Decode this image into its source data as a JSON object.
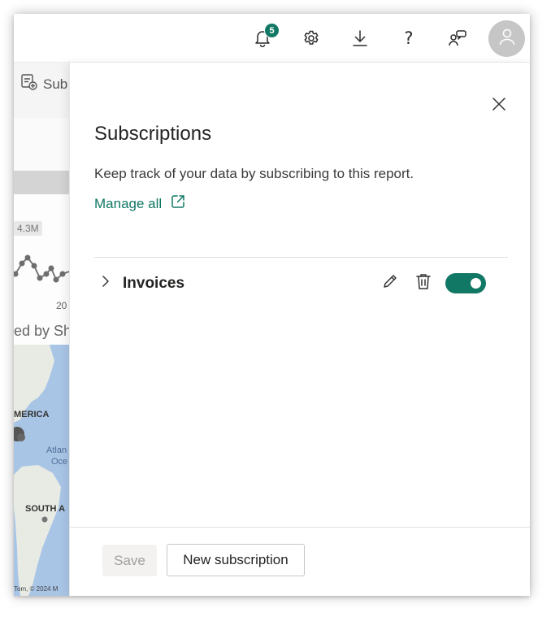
{
  "header": {
    "notifications": {
      "icon": "bell-icon",
      "count": "5"
    },
    "settings_icon": "gear-icon",
    "download_icon": "download-icon",
    "help_icon": "question-mark-icon",
    "help_glyph": "?",
    "feedback_icon": "feedback-people-icon",
    "avatar_icon": "person-icon"
  },
  "background_report": {
    "toolbar_button_partial": "Sub",
    "axis_value": "4.3M",
    "x_tick": "20",
    "map_caption_partial": "ed by Sh",
    "map_labels": {
      "north_america_partial": "MERICA",
      "atlantic_partial": "Atlan",
      "ocean_partial": "Oce",
      "south_america_partial": "SOUTH A",
      "copyright_partial": "Tom, © 2024 M"
    }
  },
  "panel": {
    "title": "Subscriptions",
    "description": "Keep track of your data by subscribing to this report.",
    "manage_link": "Manage all",
    "subscriptions": [
      {
        "name": "Invoices",
        "enabled": true
      }
    ],
    "save_label": "Save",
    "new_subscription_label": "New subscription"
  },
  "colors": {
    "accent": "#117865",
    "avatar_bg": "#c6c6c6",
    "disabled_bg": "#f3f2f1",
    "disabled_text": "#a19f9d"
  }
}
